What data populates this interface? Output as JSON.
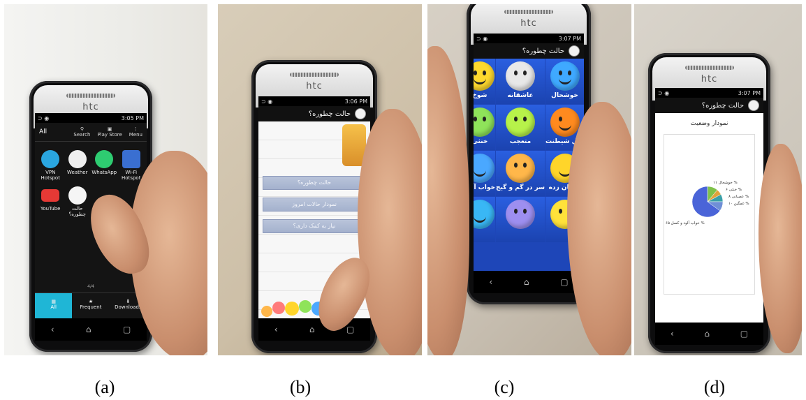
{
  "captions": [
    "(a)",
    "(b)",
    "(c)",
    "(d)"
  ],
  "phone_brand": "htc",
  "status": {
    "clock_a": "3:05 PM",
    "clock_b": "3:06 PM",
    "clock_c": "3:07 PM",
    "clock_d": "3:07 PM"
  },
  "app_title": "حالت چطوره؟",
  "launcher": {
    "header_label": "All",
    "header_actions": [
      "Search",
      "Play Store",
      "Menu"
    ],
    "apps": [
      {
        "label": "VPN Hotspot",
        "color": "#2aa6e0"
      },
      {
        "label": "Weather",
        "color": "#f0f0f0"
      },
      {
        "label": "WhatsApp",
        "color": "#2ecc71"
      },
      {
        "label": "Wi-Fi Hotspot",
        "color": "#3a6fd1"
      },
      {
        "label": "YouTube",
        "color": "#e53935"
      },
      {
        "label": "حالت چطوره؟",
        "color": "#f5f5f5"
      }
    ],
    "page_indicator": "4/4",
    "dock": [
      "All",
      "Frequent",
      "Downloads"
    ]
  },
  "home_menu": [
    "حالت چطوره؟",
    "نمودار حالات امروز",
    "نیاز به کمک داری؟"
  ],
  "moods": [
    {
      "label": "خوشحال",
      "color": "#3fa9ff"
    },
    {
      "label": "عاشقانه",
      "color": "#e8e8e8"
    },
    {
      "label": "شوخ",
      "color": "#ffd92e"
    },
    {
      "label": "اهل شیطنت",
      "color": "#ff8a1f"
    },
    {
      "label": "متعجب",
      "color": "#b7f24a"
    },
    {
      "label": "خنثی",
      "color": "#8fe35a"
    },
    {
      "label": "هیجان زده",
      "color": "#ffd52a"
    },
    {
      "label": "سر در گم و گیج",
      "color": "#ffb74a"
    },
    {
      "label": "خواب آلود",
      "color": "#4aa8ff"
    },
    {
      "label": "",
      "color": "#ffe23a"
    },
    {
      "label": "",
      "color": "#9d8ff0"
    },
    {
      "label": "",
      "color": "#39b7f5"
    }
  ],
  "chart": {
    "title": "نمودار وضعیت",
    "slices": [
      {
        "label": "خوشحال ۱۱ %",
        "color": "#7fc24a",
        "value": 11
      },
      {
        "label": "خنثی ۶ %",
        "color": "#e0a33c",
        "value": 6
      },
      {
        "label": "عصبانی ۸ %",
        "color": "#3aa0a8",
        "value": 8
      },
      {
        "label": "غمگین ۱۰ %",
        "color": "#6f8fd6",
        "value": 10
      },
      {
        "label": "خواب آلود و کسل ۶۵ %",
        "color": "#4a64d8",
        "value": 65
      }
    ]
  }
}
